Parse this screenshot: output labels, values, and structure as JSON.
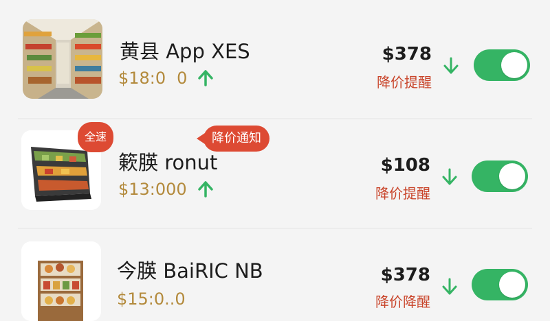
{
  "items": [
    {
      "title": "黄县 App XES",
      "price_sub": "$18:0",
      "extra_sub": "0",
      "price": "$378",
      "alert": "降价提醒",
      "thumb_icon": "grocery-aisle-image",
      "toggle_on": true
    },
    {
      "title": "簌朠 ronut",
      "price_sub": "$13:000",
      "extra_sub": "",
      "price": "$108",
      "alert": "降价提醒",
      "thumb_icon": "snack-shelf-image",
      "toggle_on": true,
      "badge": "全速",
      "bubble": "降价通知"
    },
    {
      "title": "今朠 BaiRIC NB",
      "price_sub": "$15:0..0",
      "extra_sub": "",
      "price": "$378",
      "alert": "降价降醒",
      "thumb_icon": "bakery-shelf-image",
      "toggle_on": true
    }
  ],
  "colors": {
    "accent_green": "#35b464",
    "alert_red": "#c9452b",
    "price_gold": "#b38a3c",
    "badge_red": "#dd4a33"
  }
}
